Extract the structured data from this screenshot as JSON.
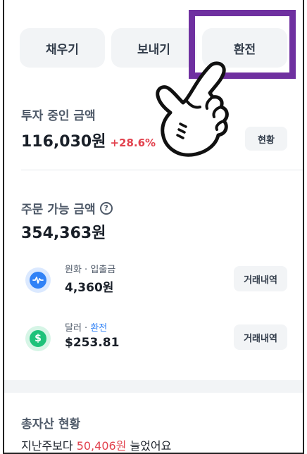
{
  "actions": {
    "fill": "채우기",
    "send": "보내기",
    "exchange": "환전"
  },
  "investing": {
    "label": "투자 중인 금액",
    "amount": "116,030원",
    "change": "+28.6%",
    "button": "현황"
  },
  "orderable": {
    "label": "주문 가능 금액",
    "help": "?",
    "amount": "354,363원"
  },
  "accounts": [
    {
      "name": "원화 · 입출금",
      "balance": "4,360원",
      "button": "거래내역"
    },
    {
      "name_prefix": "달러 · ",
      "name_link": "환전",
      "balance": "$253.81",
      "button": "거래내역",
      "icon_glyph": "$"
    }
  ],
  "summary": {
    "label": "총자산 현황",
    "prefix": "지난주보다 ",
    "amount": "50,406원",
    "suffix": " 늘었어요"
  },
  "colors": {
    "highlight": "#6f30a0",
    "gain": "#e2424e",
    "link": "#3182f6"
  }
}
